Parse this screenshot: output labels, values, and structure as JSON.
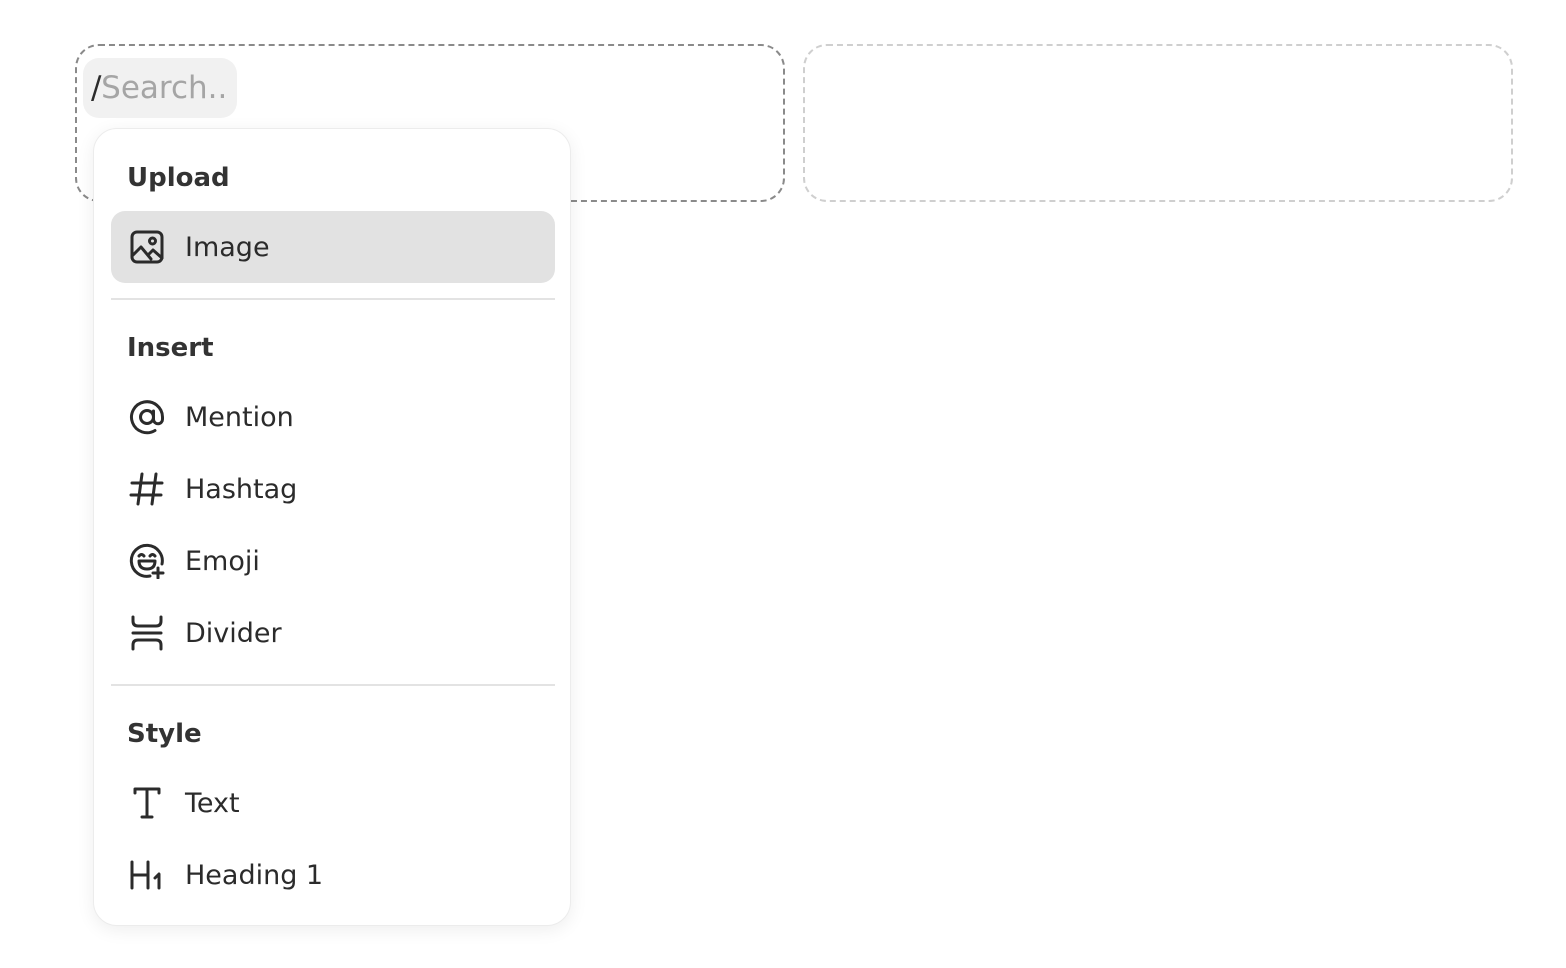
{
  "search": {
    "prefix": "/",
    "placeholder": "Search...",
    "value": ""
  },
  "menu": {
    "groups": [
      {
        "label": "Upload",
        "items": [
          {
            "label": "Image",
            "icon": "image-icon",
            "active": true
          }
        ]
      },
      {
        "label": "Insert",
        "items": [
          {
            "label": "Mention",
            "icon": "at-sign-icon"
          },
          {
            "label": "Hashtag",
            "icon": "hashtag-icon"
          },
          {
            "label": "Emoji",
            "icon": "emoji-add-icon"
          },
          {
            "label": "Divider",
            "icon": "divider-icon"
          }
        ]
      },
      {
        "label": "Style",
        "items": [
          {
            "label": "Text",
            "icon": "text-icon"
          },
          {
            "label": "Heading 1",
            "icon": "heading-1-icon"
          }
        ]
      }
    ]
  },
  "colors": {
    "active_item_bg": "#e2e2e2",
    "search_pill_bg": "#f1f1f1",
    "text": "#2b2b2b",
    "placeholder": "#a5a5a5"
  }
}
